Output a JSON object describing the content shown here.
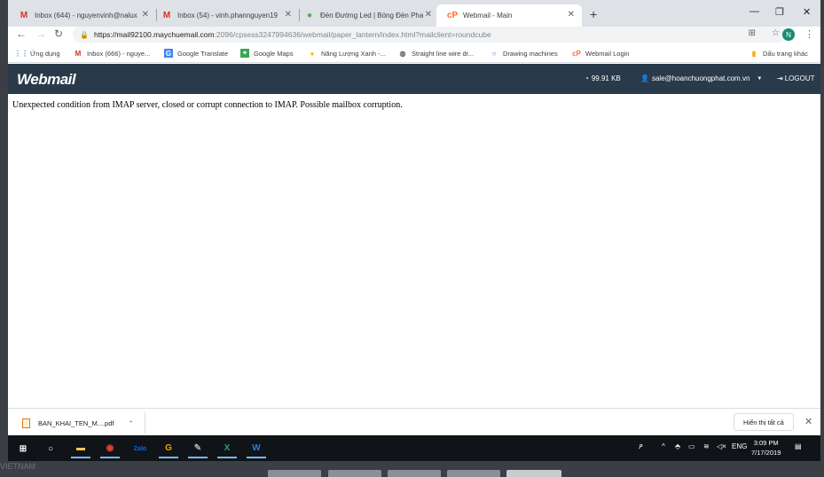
{
  "tabs": [
    {
      "title": "Inbox (644) - nguyenvinh@nalux",
      "icon": "gmail-icon"
    },
    {
      "title": "Inbox (54) - vinh.phannguyen19",
      "icon": "gmail-icon"
    },
    {
      "title": "Đèn Đường Led | Bóng Đèn Pha",
      "icon": "page-icon"
    },
    {
      "title": "Webmail - Main",
      "icon": "cpanel-icon"
    }
  ],
  "omnibox": {
    "host": "https://mail92100.maychuemail.com",
    "path": ":2096/cpsess3247994636/webmail/paper_lantern/index.html?mailclient=roundcube"
  },
  "profile_initial": "N",
  "bookmarks": [
    {
      "label": "Ứng dụng",
      "icon": "apps-grid-icon"
    },
    {
      "label": "Inbox (666) - nguye...",
      "icon": "gmail-icon"
    },
    {
      "label": "Google Translate",
      "icon": "translate-icon"
    },
    {
      "label": "Google Maps",
      "icon": "maps-icon"
    },
    {
      "label": "Năng Lượng Xanh -...",
      "icon": "energy-icon"
    },
    {
      "label": "Straight line wire dr...",
      "icon": "globe-icon"
    },
    {
      "label": "Drawing machines",
      "icon": "circle-icon"
    },
    {
      "label": "Webmail Login",
      "icon": "cpanel-icon"
    },
    {
      "label": "Dấu trang khác",
      "icon": "folder-icon"
    }
  ],
  "webmail": {
    "logo": "Webmail",
    "quota": "99.91 KB",
    "user": "sale@hoanchuongphat.com.vn",
    "logout": "LOGOUT",
    "error": "Unexpected condition from IMAP server, closed or corrupt connection to IMAP. Possible mailbox corruption."
  },
  "downloads": {
    "file": "BAN_KHAI_TEN_M....pdf",
    "show_all": "Hiển thị tất cả"
  },
  "taskbar": {
    "lang": "ENG",
    "time": "3:09 PM",
    "date": "7/17/2019"
  },
  "background_label": "VIETNAM",
  "colors": {
    "header_bg": "#293a4a",
    "tabstrip_bg": "#dee1e6",
    "taskbar_bg": "#101418"
  }
}
